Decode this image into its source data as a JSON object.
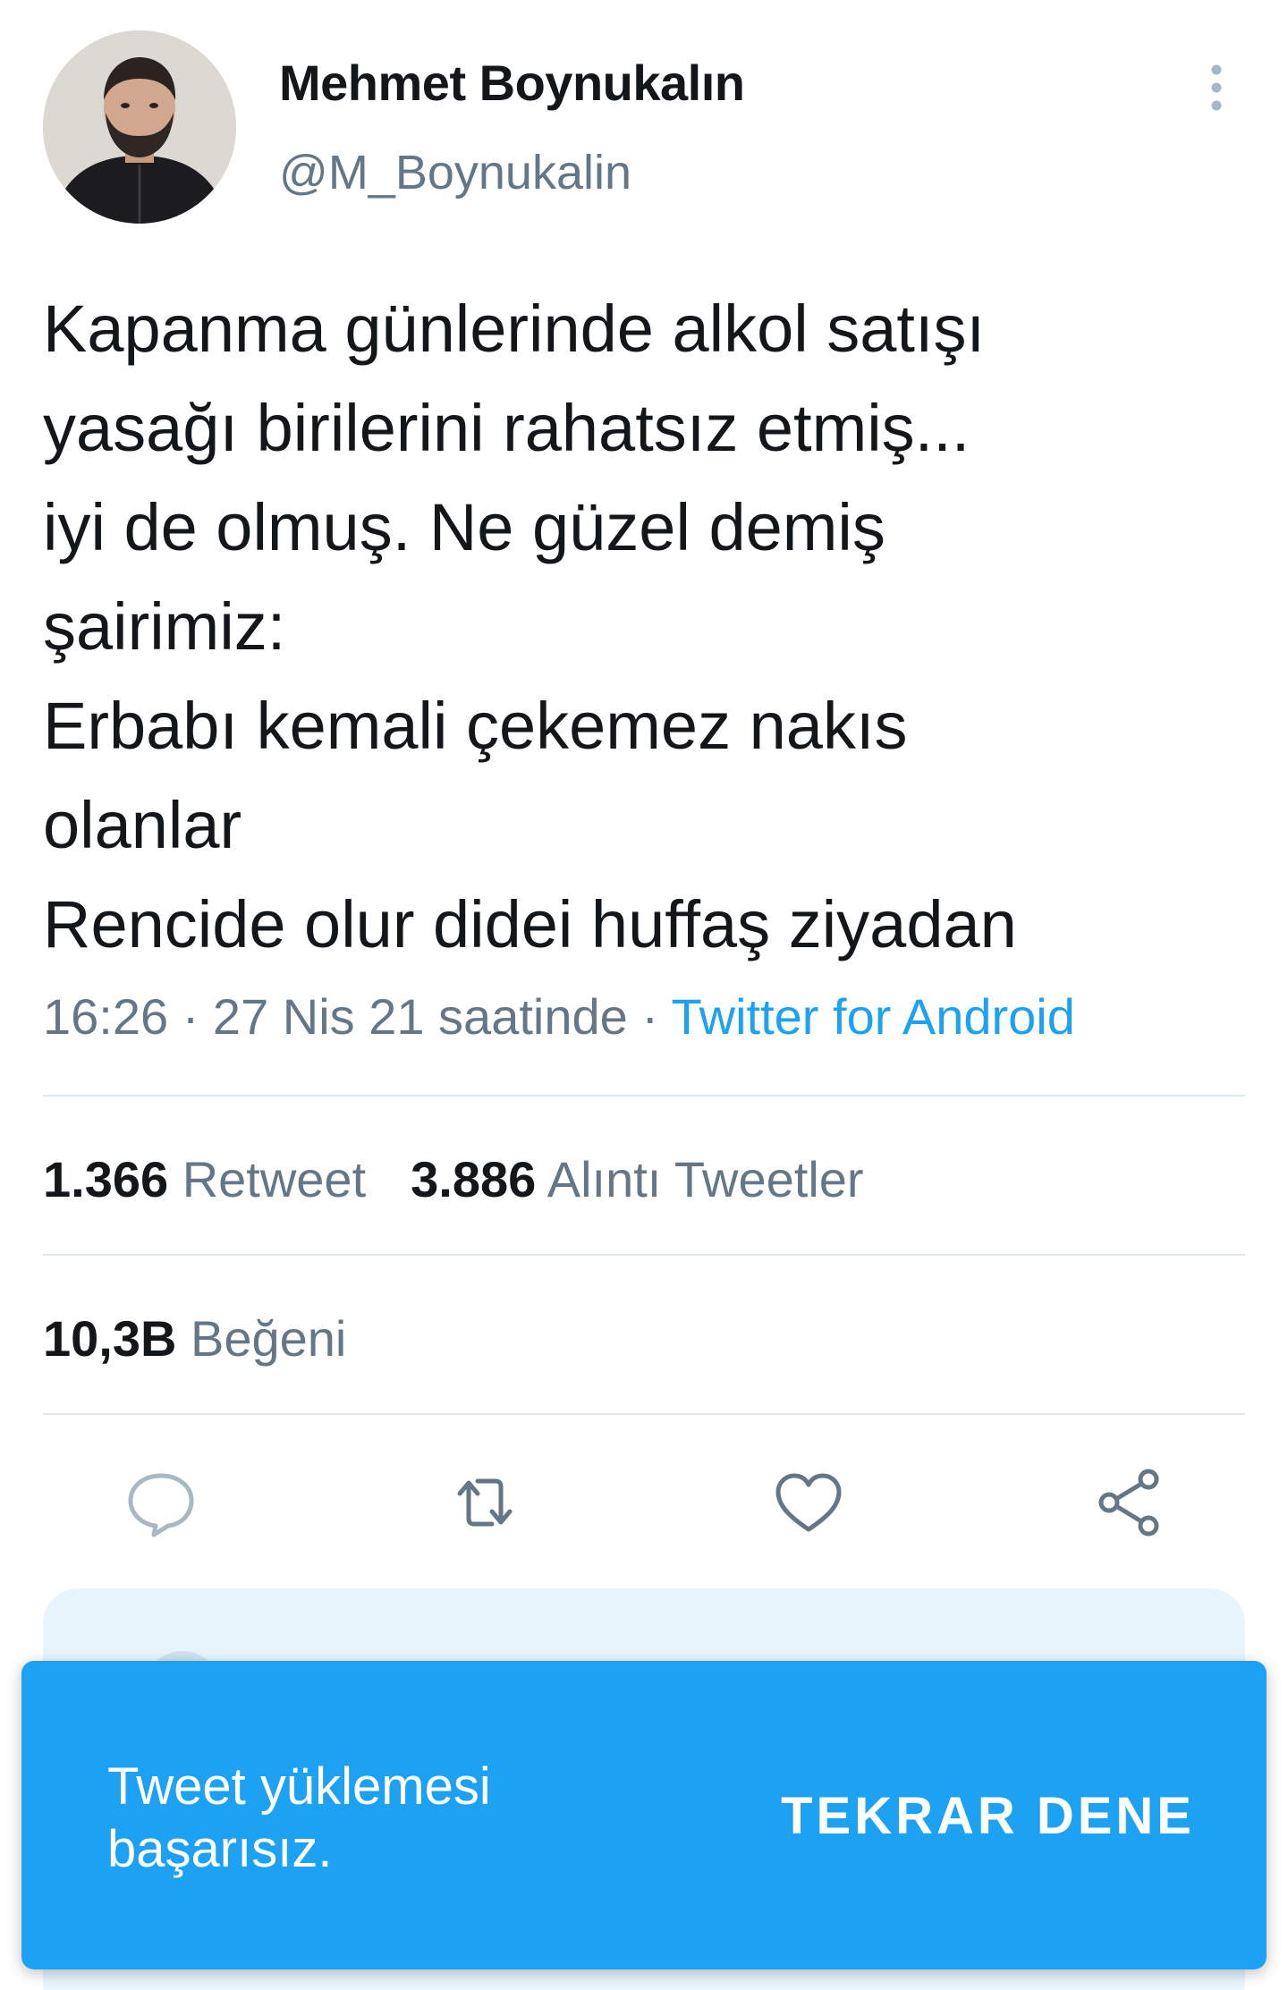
{
  "author": {
    "display_name": "Mehmet Boynukalın",
    "handle": "@M_Boynukalin"
  },
  "tweet": {
    "lines": [
      "Kapanma günlerinde alkol satışı",
      "yasağı birilerini rahatsız etmiş...",
      "iyi de olmuş. Ne güzel demiş",
      "şairimiz:",
      "Erbabı kemali çekemez nakıs",
      "olanlar",
      "Rencide olur didei huffaş ziyadan"
    ],
    "time": "16:26",
    "date": "27 Nis 21 saatinde",
    "separator": "·",
    "source": "Twitter for Android"
  },
  "stats": {
    "retweets_count": "1.366",
    "retweets_label": "Retweet",
    "quotes_count": "3.886",
    "quotes_label": "Alıntı Tweetler",
    "likes_count": "10,3B",
    "likes_label": "Beğeni"
  },
  "actions": [
    {
      "icon": "reply-icon"
    },
    {
      "icon": "retweet-icon"
    },
    {
      "icon": "like-icon"
    },
    {
      "icon": "share-icon"
    }
  ],
  "snackbar": {
    "message": "Tweet yüklemesi başarısız.",
    "action_label": "TEKRAR DENE"
  },
  "colors": {
    "accent": "#1da1f2",
    "text_primary": "#14171a",
    "text_secondary": "#657786",
    "divider": "#e1e8ed",
    "icon": "#657786"
  }
}
